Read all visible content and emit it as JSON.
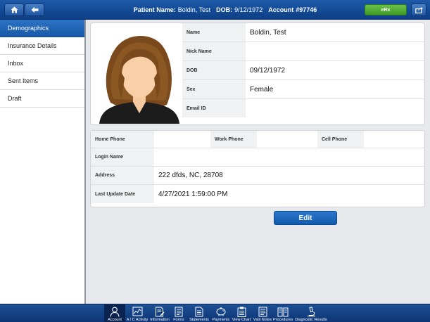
{
  "header": {
    "patient_name_label": "Patient Name:",
    "patient_name": "Boldin, Test",
    "dob_label": "DOB:",
    "dob": "9/12/1972",
    "account_label": "Account",
    "account": "#97746",
    "erx_label": "eRx"
  },
  "nav": {
    "items": [
      {
        "label": "Demographics"
      },
      {
        "label": "Insurance Details"
      },
      {
        "label": "Inbox"
      },
      {
        "label": "Sent Items"
      },
      {
        "label": "Draft"
      }
    ]
  },
  "profile": {
    "name_label": "Name",
    "name": "Boldin, Test",
    "nick_label": "Nick Name",
    "nick": "",
    "dob_label": "DOB",
    "dob": "09/12/1972",
    "sex_label": "Sex",
    "sex": "Female",
    "email_label": "Email ID",
    "email": ""
  },
  "contact": {
    "home_phone_label": "Home Phone",
    "home_phone": "",
    "work_phone_label": "Work Phone",
    "work_phone": "",
    "cell_phone_label": "Cell Phone",
    "cell_phone": "",
    "login_label": "Login Name",
    "login": "",
    "address_label": "Address",
    "address": "222 dfds, NC, 28708",
    "last_update_label": "Last Update Date",
    "last_update": "4/27/2021 1:59:00 PM"
  },
  "edit_label": "Edit",
  "toolbar": {
    "items": [
      {
        "label": "Account",
        "icon": "person-icon"
      },
      {
        "label": "A / C Activity",
        "icon": "chart-icon"
      },
      {
        "label": "Information",
        "icon": "document-edit-icon"
      },
      {
        "label": "Forms",
        "icon": "forms-icon"
      },
      {
        "label": "Statements",
        "icon": "statement-icon"
      },
      {
        "label": "Payments",
        "icon": "piggy-bank-icon"
      },
      {
        "label": "View Chart",
        "icon": "clipboard-icon"
      },
      {
        "label": "Visit Notes",
        "icon": "notes-icon"
      },
      {
        "label": "Procedures",
        "icon": "procedures-icon"
      },
      {
        "label": "Diagnostic Results",
        "icon": "microscope-icon"
      }
    ]
  },
  "colors": {
    "header": "#1d5aa8",
    "nav_active": "#2c72c4",
    "erx": "#4fae35",
    "edit": "#1d68bd",
    "toolbar": "#153f82"
  }
}
